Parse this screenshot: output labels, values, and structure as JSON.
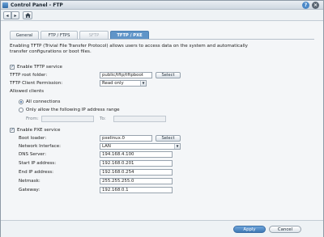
{
  "window": {
    "title": "Control Panel - FTP"
  },
  "toolbar": {
    "back_icon": "arrow-left",
    "forward_icon": "arrow-right",
    "home_icon": "home"
  },
  "tabs": [
    {
      "label": "General",
      "state": "normal"
    },
    {
      "label": "FTP / FTPS",
      "state": "normal"
    },
    {
      "label": "SFTP",
      "state": "disabled"
    },
    {
      "label": "TFTP / PXE",
      "state": "active"
    }
  ],
  "tftp": {
    "description": "Enabling TFTP (Trivial File Transfer Protocol) allows users to access data on the system and automatically transfer configurations or boot files.",
    "enable_label": "Enable TFTP service",
    "enable_checked": true,
    "root_folder_label": "TFTP root folder:",
    "root_folder_value": "public/tftp/tftpboot",
    "select_label": "Select",
    "permission_label": "TFTP Client Permission:",
    "permission_value": "Read only",
    "allowed_clients_label": "Allowed clients",
    "all_connections_label": "All connections",
    "only_allow_label": "Only allow the following IP address range",
    "from_label": "From:",
    "from_value": "",
    "to_label": "To:",
    "to_value": ""
  },
  "pxe": {
    "enable_label": "Enable PXE service",
    "enable_checked": true,
    "boot_loader_label": "Boot loader:",
    "boot_loader_value": "pxelinux.0",
    "select_label": "Select",
    "interface_label": "Network Interface:",
    "interface_value": "LAN",
    "dns_label": "DNS Server:",
    "dns_value": "194.168.4.100",
    "start_ip_label": "Start IP address:",
    "start_ip_value": "192.168.0.201",
    "end_ip_label": "End IP address:",
    "end_ip_value": "192.168.0.254",
    "netmask_label": "Netmask:",
    "netmask_value": "255.255.255.0",
    "gateway_label": "Gateway:",
    "gateway_value": "192.168.0.1"
  },
  "footer": {
    "apply_label": "Apply",
    "cancel_label": "Cancel"
  },
  "colors": {
    "accent": "#5f94c8",
    "apply": "#3f78b4"
  }
}
